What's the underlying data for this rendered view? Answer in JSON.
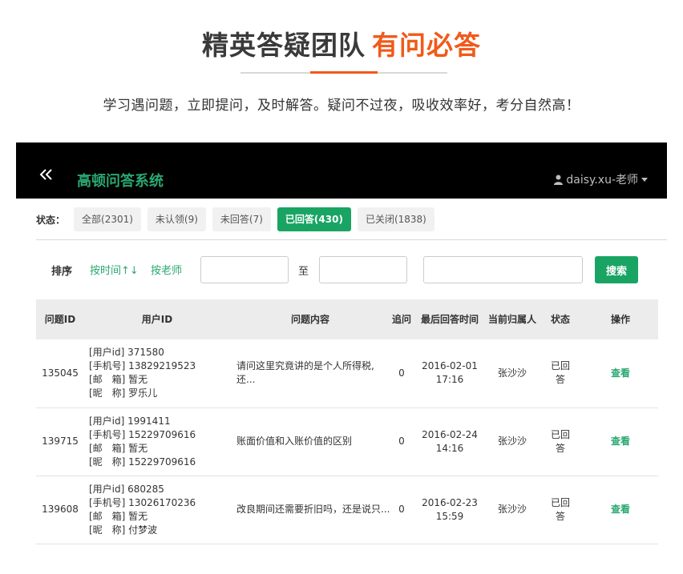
{
  "hero": {
    "title_main": "精英答疑团队",
    "title_accent": "有问必答",
    "subtitle": "学习遇问题，立即提问，及时解答。疑问不过夜，吸收效率好，考分自然高！"
  },
  "app": {
    "title": "高顿问答系统",
    "user_label": "daisy.xu-老师",
    "icons": [
      "double-chevron-left-icon",
      "user-icon",
      "caret-down-icon"
    ]
  },
  "filter": {
    "status_label": "状态：",
    "tabs": [
      {
        "label": "全部(2301)",
        "active": false
      },
      {
        "label": "未认领(9)",
        "active": false
      },
      {
        "label": "未回答(7)",
        "active": false
      },
      {
        "label": "已回答(430)",
        "active": true
      },
      {
        "label": "已关闭(1838)",
        "active": false
      }
    ]
  },
  "sort": {
    "label": "排序",
    "by_time": "按时间↑↓",
    "by_teacher": "按老师",
    "to_label": "至",
    "date_from": "",
    "date_to": "",
    "keyword": "",
    "search_label": "搜索"
  },
  "table": {
    "headers": [
      "问题ID",
      "用户ID",
      "问题内容",
      "追问",
      "最后回答时间",
      "当前归属人",
      "状态",
      "操作"
    ],
    "rows": [
      {
        "id": "135045",
        "user": [
          "[用户id] 371580",
          "[手机号] 13829219523",
          "[邮　箱] 暂无",
          "[昵　称] 罗乐儿"
        ],
        "content": "请问这里究竟讲的是个人所得税,还...",
        "followups": "0",
        "last_time": [
          "2016-02-01",
          "17:16"
        ],
        "owner": "张沙沙",
        "status": [
          "已回",
          "答"
        ],
        "action": "查看"
      },
      {
        "id": "139715",
        "user": [
          "[用户id] 1991411",
          "[手机号] 15229709616",
          "[邮　箱] 暂无",
          "[昵　称] 15229709616"
        ],
        "content": "账面价值和入账价值的区别",
        "followups": "0",
        "last_time": [
          "2016-02-24",
          "14:16"
        ],
        "owner": "张沙沙",
        "status": [
          "已回",
          "答"
        ],
        "action": "查看"
      },
      {
        "id": "139608",
        "user": [
          "[用户id] 680285",
          "[手机号] 13026170236",
          "[邮　箱] 暂无",
          "[昵　称] 付梦波"
        ],
        "content": "改良期间还需要折旧吗，还是说只...",
        "followups": "0",
        "last_time": [
          "2016-02-23",
          "15:59"
        ],
        "owner": "张沙沙",
        "status": [
          "已回",
          "答"
        ],
        "action": "查看"
      }
    ]
  },
  "colors": {
    "accent_orange": "#f05a1a",
    "brand_green": "#19a463",
    "title_green": "#2aa870",
    "app_bar": "#000000"
  }
}
